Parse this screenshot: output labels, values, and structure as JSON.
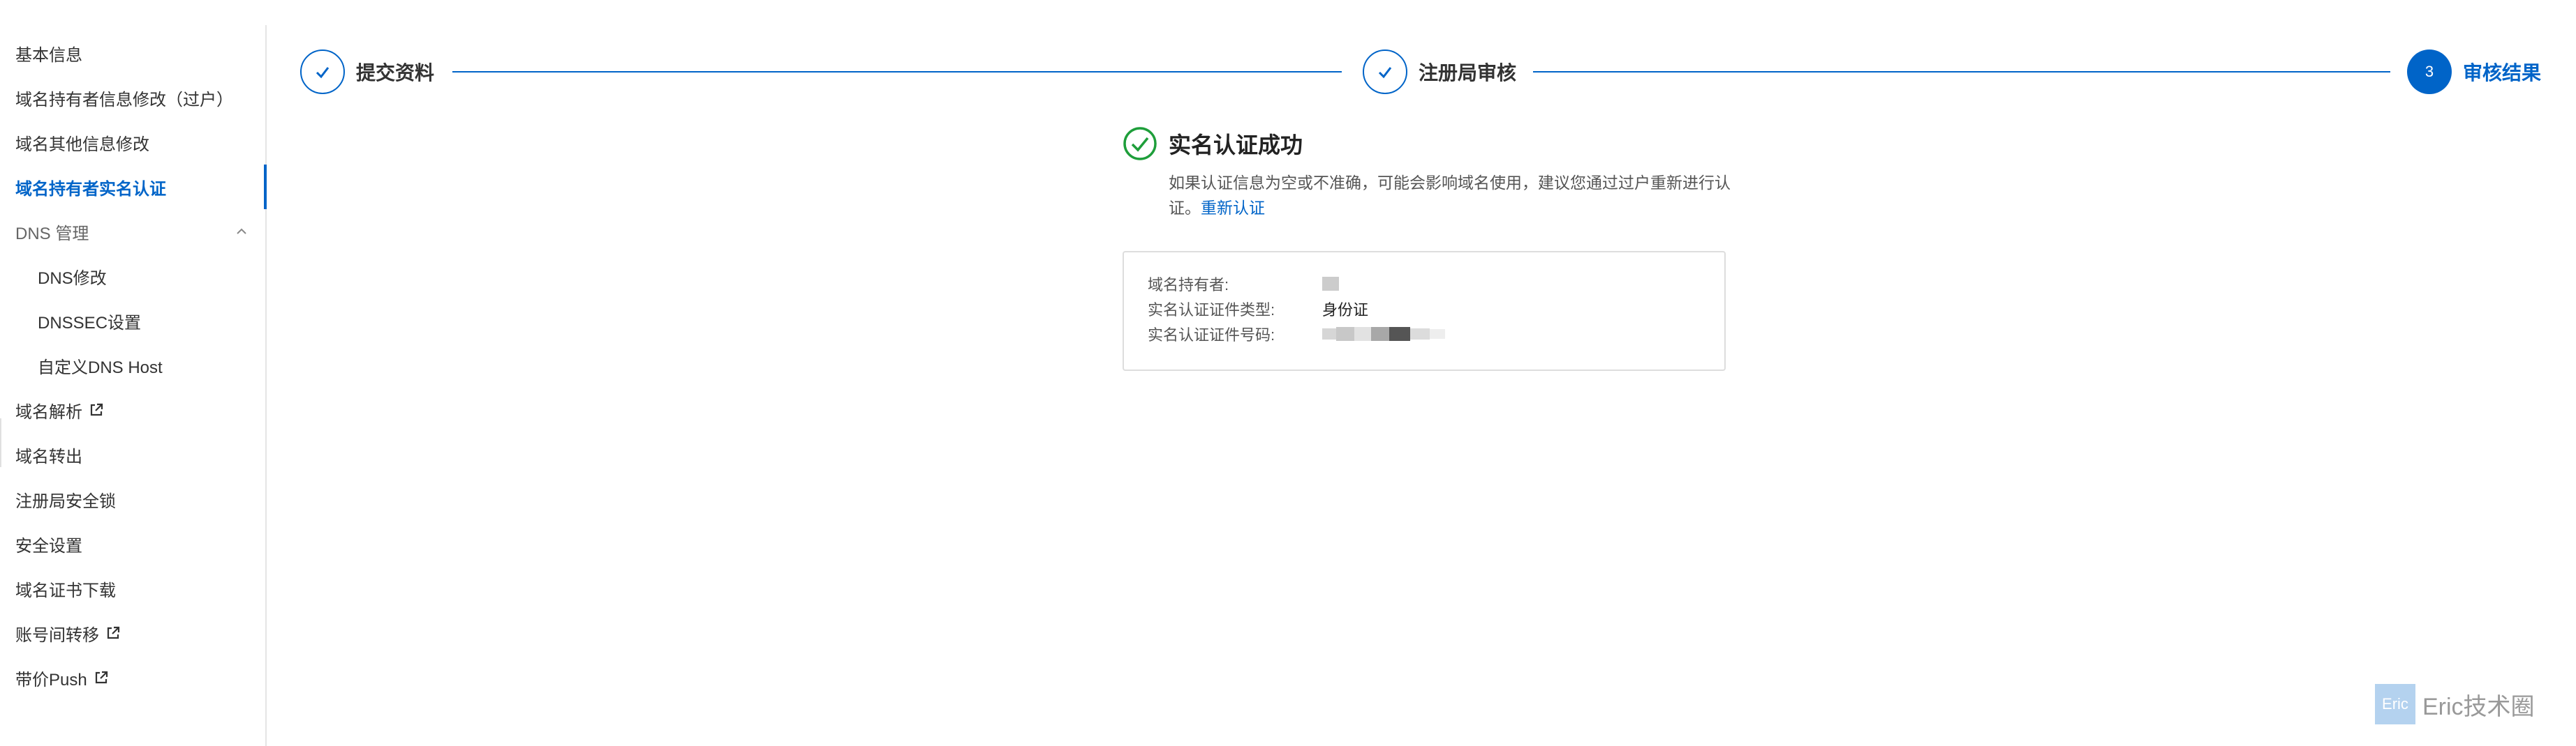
{
  "sidebar": {
    "items": [
      {
        "label": "基本信息"
      },
      {
        "label": "域名持有者信息修改（过户）"
      },
      {
        "label": "域名其他信息修改"
      },
      {
        "label": "域名持有者实名认证"
      },
      {
        "label": "DNS 管理"
      },
      {
        "label": "DNS修改"
      },
      {
        "label": "DNSSEC设置"
      },
      {
        "label": "自定义DNS Host"
      },
      {
        "label": "域名解析"
      },
      {
        "label": "域名转出"
      },
      {
        "label": "注册局安全锁"
      },
      {
        "label": "安全设置"
      },
      {
        "label": "域名证书下载"
      },
      {
        "label": "账号间转移"
      },
      {
        "label": "带价Push"
      }
    ],
    "active_index": 3,
    "icons": {
      "expand": "chevron-up-icon",
      "external": "external-link-icon"
    }
  },
  "steps": [
    {
      "label": "提交资料",
      "status": "done"
    },
    {
      "label": "注册局审核",
      "status": "done"
    },
    {
      "number": "3",
      "label": "审核结果",
      "status": "current"
    }
  ],
  "result": {
    "title": "实名认证成功",
    "desc_text": "如果认证信息为空或不准确，可能会影响域名使用，建议您通过过户重新进行认证。",
    "desc_link": "重新认证",
    "icon": "check-circle-icon"
  },
  "info": {
    "rows": [
      {
        "label": "域名持有者:",
        "value": ""
      },
      {
        "label": "实名认证证件类型:",
        "value": "身份证"
      },
      {
        "label": "实名认证证件号码:",
        "value": ""
      }
    ]
  },
  "watermark": {
    "logo": "Eric",
    "text": "Eric技术圈"
  },
  "colors": {
    "primary": "#0064c8",
    "success": "#1e9e3a"
  }
}
